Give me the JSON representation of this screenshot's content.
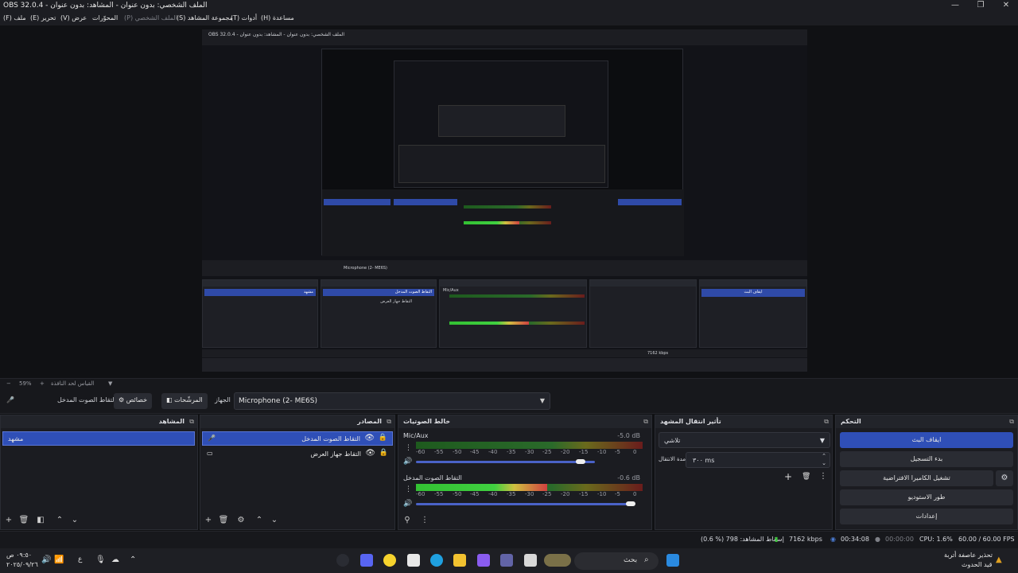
{
  "window": {
    "title": "OBS 32.0.4 - الملف الشخصي: بدون عنوان - المشاهد: بدون عنوان",
    "minimize_icon": "—",
    "restore_icon": "❐",
    "close_icon": "✕"
  },
  "menu": {
    "file": "(F) ملف",
    "edit": "(E) تحرير",
    "view": "(V) عرض",
    "docks": "المحوّرات",
    "profile": "(P) الملف الشخصي",
    "scene_collection": "(S) مجموعة المشاهد",
    "tools": "(T) أدوات",
    "help": "(H) مساعدة"
  },
  "preview": {
    "nested_title": "OBS 32.0.4 - الملف الشخصي: بدون عنوان - المشاهد: بدون عنوان",
    "nested_scene": "مشهد",
    "nested_source_1": "التقاط الصوت المدخل",
    "nested_source_2": "التقاط جهاز العرض",
    "nested_device": "Microphone (2- ME6S)",
    "nested_mic": "Mic/Aux",
    "nested_stop": "ايقاف البث",
    "nested_kbps": "7162 kbps"
  },
  "zoom": {
    "minus": "−",
    "value": "59%",
    "plus": "+",
    "fit_label": "القياس لحد النافذة"
  },
  "source_bar": {
    "mic_icon": "🎤",
    "source_name": "التقاط الصوت المدخل",
    "properties": "خصائص",
    "filters": "المرشّحات",
    "device_label": "الجهاز",
    "device_value": "Microphone (2- ME6S)",
    "dropdown_icon": "▼"
  },
  "scenes": {
    "title": "المشاهد",
    "items": [
      "مشهد"
    ]
  },
  "sources": {
    "title": "المصادر",
    "items": [
      {
        "label": "التقاط الصوت المدخل",
        "icon": "🎤",
        "selected": true
      },
      {
        "label": "التقاط جهاز العرض",
        "icon": "▭",
        "selected": false
      }
    ]
  },
  "mixer": {
    "title": "خالط الصوتيات",
    "channels": [
      {
        "name": "Mic/Aux",
        "db": "-5.0 dB",
        "level": 0.0,
        "volume": 0.92
      },
      {
        "name": "التقاط الصوت المدخل",
        "db": "-0.6 dB",
        "level": 0.58,
        "volume": 0.98
      }
    ],
    "scale": [
      "-60",
      "-55",
      "-50",
      "-45",
      "-40",
      "-35",
      "-30",
      "-25",
      "-20",
      "-15",
      "-10",
      "-5",
      "0"
    ]
  },
  "transitions": {
    "title": "تأثير انتقال المشهد",
    "type": "تلاشي",
    "duration_label": "مدة الانتقال",
    "duration_value": "٣٠٠ ms"
  },
  "controls": {
    "title": "التحكم",
    "stop_stream": "ايقاف البث",
    "start_record": "بدء التسجيل",
    "virtual_cam": "تشغيل الكاميرا الافتراضية",
    "studio_mode": "طور الاستوديو",
    "settings": "إعدادات"
  },
  "status": {
    "dropped": "(0.6 %) 798 :إسقاط المشاهد",
    "kbps": "7162 kbps",
    "stream_time": "00:34:08",
    "rec_time": "00:00:00",
    "cpu": "CPU: 1.6%",
    "fps": "60.00 / 60.00 FPS"
  },
  "taskbar": {
    "time": "٠٩:٥٠ ص",
    "date": "٢٠٢٥/٠٩/٢٦",
    "lang": "ع",
    "search": "بحث",
    "weather_title": "تحذير عاصفة أتربة",
    "weather_sub": "قيد الحدوث",
    "accent": "#2f4fb7"
  }
}
